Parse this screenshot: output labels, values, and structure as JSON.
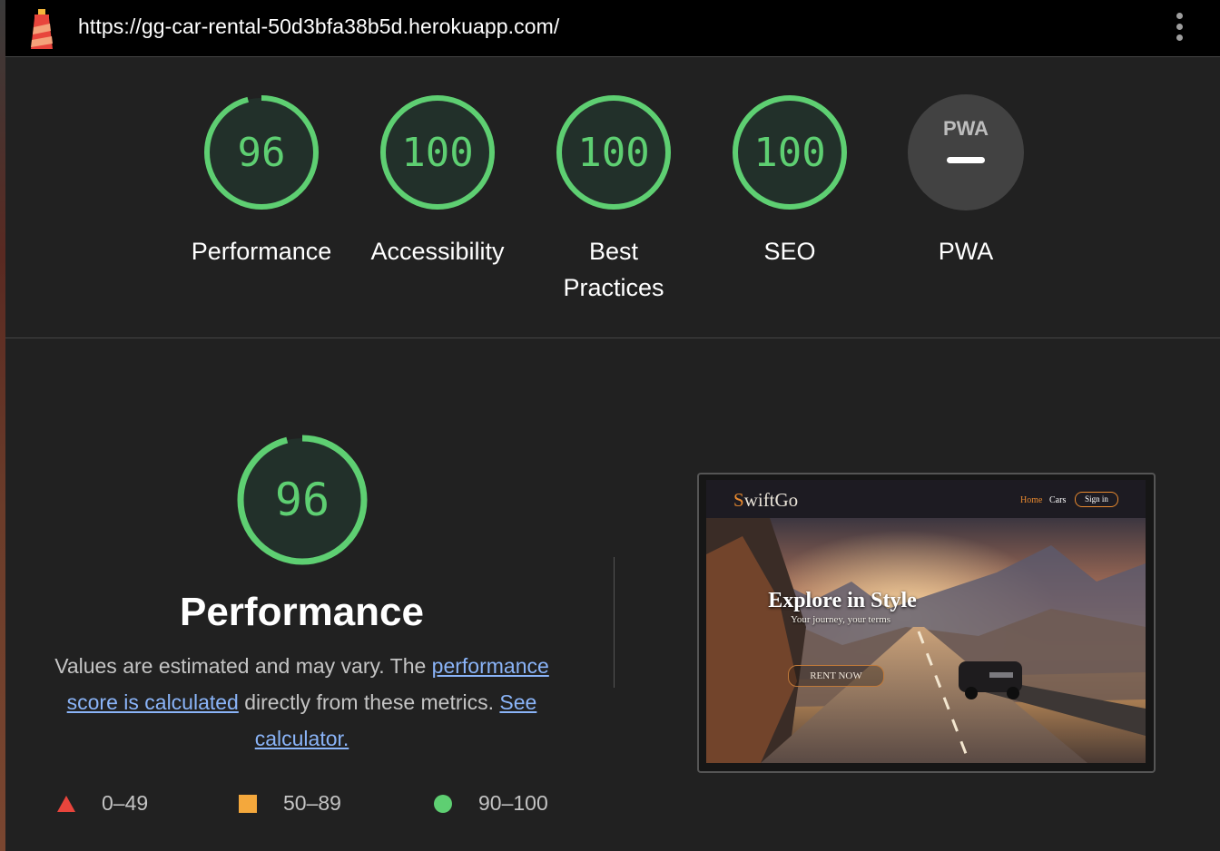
{
  "topbar": {
    "url": "https://gg-car-rental-50d3bfa38b5d.herokuapp.com/",
    "logo_icon": "lighthouse-icon",
    "menu_icon": "kebab-menu-icon"
  },
  "gauges": [
    {
      "label": "Performance",
      "score": "96",
      "fraction": 0.96,
      "status": "pass"
    },
    {
      "label": "Accessibility",
      "score": "100",
      "fraction": 1.0,
      "status": "pass"
    },
    {
      "label": "Best Practices",
      "score": "100",
      "fraction": 1.0,
      "status": "pass"
    },
    {
      "label": "SEO",
      "score": "100",
      "fraction": 1.0,
      "status": "pass"
    },
    {
      "label": "PWA",
      "score": "",
      "fraction": 0,
      "status": "na",
      "badge": "PWA"
    }
  ],
  "performance": {
    "score": "96",
    "fraction": 0.96,
    "title": "Performance",
    "desc_prefix": "Values are estimated and may vary. The ",
    "link_score": "performance score is calculated",
    "desc_middle": " directly from these metrics. ",
    "link_calc": "See calculator."
  },
  "legend": [
    {
      "range": "0–49",
      "shape": "triangle",
      "color": "#e8453c"
    },
    {
      "range": "50–89",
      "shape": "square",
      "color": "#f4a83c"
    },
    {
      "range": "90–100",
      "shape": "circle",
      "color": "#5ecf72"
    }
  ],
  "screenshot": {
    "logo_first": "S",
    "logo_rest": "wiftGo",
    "nav_home": "Home",
    "nav_cars": "Cars",
    "nav_signin": "Sign in",
    "hero_title": "Explore in Style",
    "hero_sub": "Your journey, your terms",
    "hero_button": "RENT NOW"
  },
  "colors": {
    "pass": "#5ecf72",
    "pass_fill": "#22302a",
    "background": "#212121",
    "link": "#8ab4f8",
    "na_fill": "#424242"
  }
}
